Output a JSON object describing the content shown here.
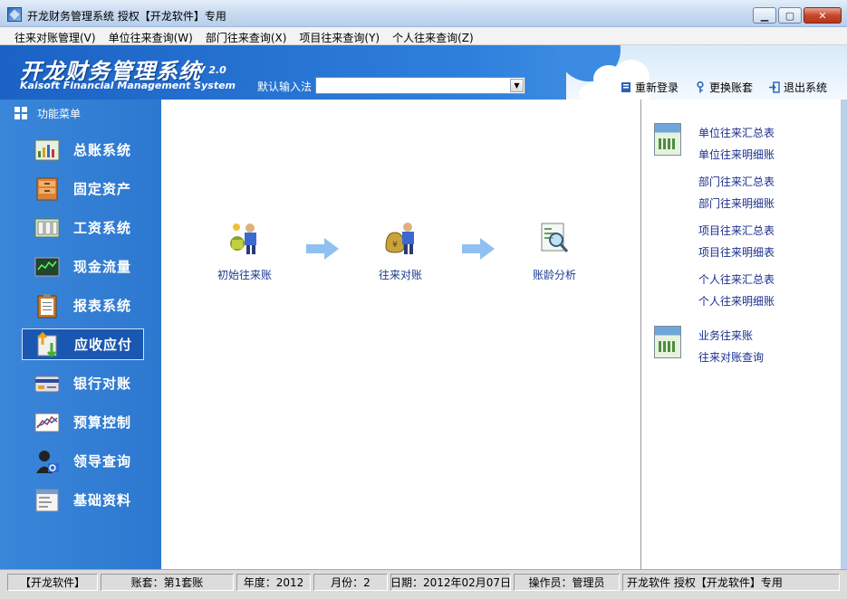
{
  "window": {
    "title": "开龙财务管理系统 授权【开龙软件】专用",
    "buttons": [
      "minimize",
      "maximize",
      "close"
    ]
  },
  "menubar": {
    "items": [
      {
        "label": "往来对账管理(V)"
      },
      {
        "label": "单位往来查询(W)"
      },
      {
        "label": "部门往来查询(X)"
      },
      {
        "label": "项目往来查询(Y)"
      },
      {
        "label": "个人往来查询(Z)"
      }
    ]
  },
  "banner": {
    "brand_cn": "开龙财务管理系统",
    "version": "V 2.0",
    "brand_en": "Kaisoft Financial Management System",
    "ime_label": "默认输入法",
    "ime_value": "",
    "actions": [
      {
        "label": "重新登录",
        "icon": "relogin-icon"
      },
      {
        "label": "更换账套",
        "icon": "key-icon"
      },
      {
        "label": "退出系统",
        "icon": "exit-icon"
      }
    ]
  },
  "sidebar": {
    "header": "功能菜单",
    "items": [
      {
        "label": "总账系统",
        "icon": "ledger-icon"
      },
      {
        "label": "固定资产",
        "icon": "cabinet-icon"
      },
      {
        "label": "工资系统",
        "icon": "salary-icon"
      },
      {
        "label": "现金流量",
        "icon": "cashflow-icon"
      },
      {
        "label": "报表系统",
        "icon": "clipboard-icon"
      },
      {
        "label": "应收应付",
        "icon": "receivable-icon"
      },
      {
        "label": "银行对账",
        "icon": "bank-card-icon"
      },
      {
        "label": "预算控制",
        "icon": "budget-chart-icon"
      },
      {
        "label": "领导查询",
        "icon": "leader-search-icon"
      },
      {
        "label": "基础资料",
        "icon": "basic-data-icon"
      }
    ],
    "active_index": 5
  },
  "main": {
    "flow": [
      {
        "label": "初始往来账",
        "icon": "initial-account-icon"
      },
      {
        "label": "往来对账",
        "icon": "reconcile-icon"
      },
      {
        "label": "账龄分析",
        "icon": "aging-analysis-icon"
      }
    ]
  },
  "right_panel": {
    "group1": [
      "单位往来汇总表",
      "单位往来明细账",
      "部门往来汇总表",
      "部门往来明细账",
      "项目往来汇总表",
      "项目往来明细表",
      "个人往来汇总表",
      "个人往来明细账"
    ],
    "group2": [
      "业务往来账",
      "往来对账查询"
    ]
  },
  "statusbar": {
    "company": "【开龙软件】",
    "account_set": "账套：第1套账",
    "year": "年度：2012",
    "month": "月份：2",
    "date": "日期：2012年02月07日",
    "operator": "操作员：管理员",
    "license": "开龙软件 授权【开龙软件】专用"
  },
  "colors": {
    "sidebar_blue": "#2d78d0",
    "link_blue": "#1a2f8c",
    "banner_blue": "#1b62c4"
  }
}
